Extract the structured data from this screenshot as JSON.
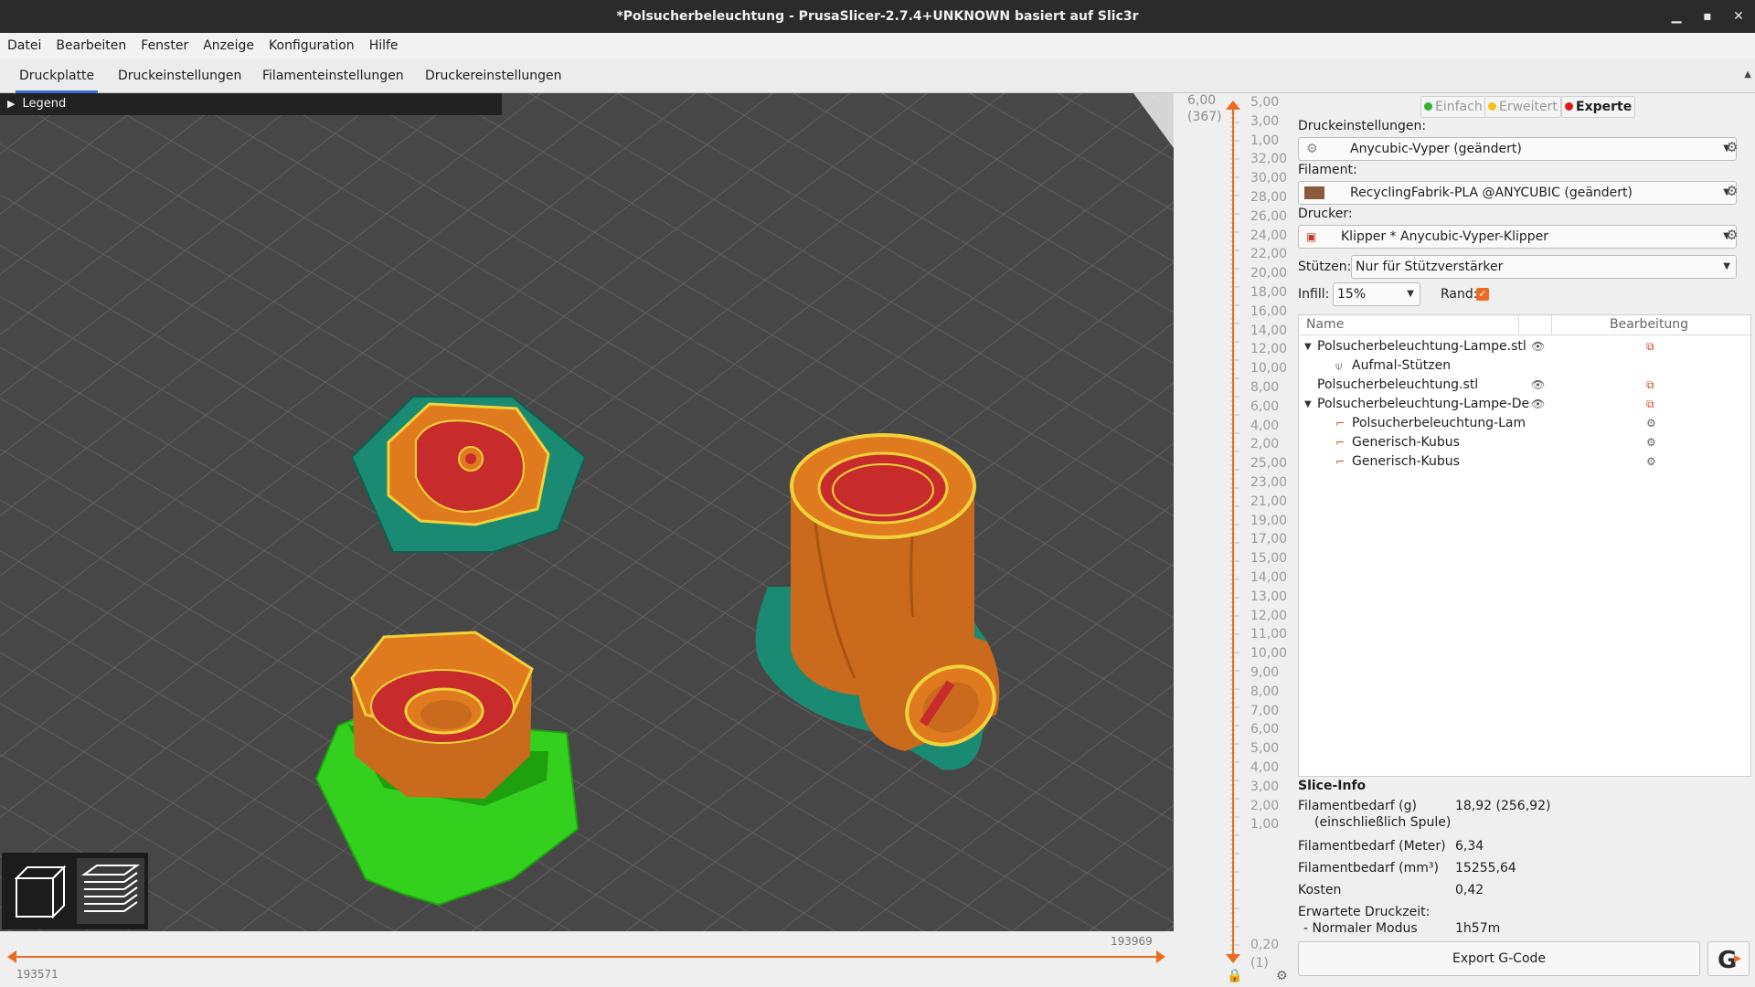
{
  "window": {
    "title": "*Polsucherbeleuchtung - PrusaSlicer-2.7.4+UNKNOWN basiert auf Slic3r",
    "minimize": "▁",
    "maximize": "▪",
    "close": "✕"
  },
  "menu": [
    "Datei",
    "Bearbeiten",
    "Fenster",
    "Anzeige",
    "Konfiguration",
    "Hilfe"
  ],
  "tabs": [
    "Druckplatte",
    "Druckeinstellungen",
    "Filamenteinstellungen",
    "Druckereinstellungen"
  ],
  "active_tab": "Druckplatte",
  "canvas": {
    "legend_label": "Legend"
  },
  "horizontal_slider": {
    "left_value": "193571",
    "right_value": "193969"
  },
  "vertical_slider": {
    "top_value": "6,00",
    "top_layer": "(367)",
    "bottom_value": "0,20",
    "bottom_layer": "(1)",
    "ticks": [
      "5,00",
      "3,00",
      "1,00",
      "32,00",
      "30,00",
      "28,00",
      "26,00",
      "24,00",
      "22,00",
      "20,00",
      "18,00",
      "16,00",
      "14,00",
      "12,00",
      "10,00",
      "8,00",
      "6,00",
      "4,00",
      "2,00",
      "25,00",
      "23,00",
      "21,00",
      "19,00",
      "17,00",
      "15,00",
      "14,00",
      "13,00",
      "12,00",
      "11,00",
      "10,00",
      "9,00",
      "8,00",
      "7,00",
      "6,00",
      "5,00",
      "4,00",
      "3,00",
      "2,00",
      "1,00"
    ]
  },
  "panel": {
    "modes": [
      {
        "label": "Einfach",
        "color": "#2ab52a"
      },
      {
        "label": "Erweitert",
        "color": "#f2c20f"
      },
      {
        "label": "Experte",
        "color": "#e0161b"
      }
    ],
    "active_mode": "Experte",
    "print_settings_label": "Druckeinstellungen:",
    "print_settings_value": "Anycubic-Vyper (geändert)",
    "filament_label": "Filament:",
    "filament_value": "RecyclingFabrik-PLA @ANYCUBIC (geändert)",
    "filament_color": "#8b5a3c",
    "printer_label": "Drucker:",
    "printer_value": "Klipper * Anycubic-Vyper-Klipper",
    "supports_label": "Stützen:",
    "supports_value": "Nur für Stützverstärker",
    "infill_label": "Infill:",
    "infill_value": "15%",
    "brim_label": "Rand:",
    "brim_checked": true
  },
  "object_list": {
    "col_name": "Name",
    "col_edit": "Bearbeitung",
    "rows": [
      {
        "name": "Polsucherbeleuchtung-Lampe.stl",
        "level": 0,
        "expanded": true,
        "eye": true,
        "edit_icon": "object-settings-icon"
      },
      {
        "name": "Aufmal-Stützen",
        "level": 1,
        "icon": "paint-supports-icon"
      },
      {
        "name": "Polsucherbeleuchtung.stl",
        "level": 0,
        "eye": true,
        "edit_icon": "object-settings-icon"
      },
      {
        "name": "Polsucherbeleuchtung-Lampe-De",
        "level": 0,
        "expanded": true,
        "eye": true,
        "edit_icon": "object-settings-icon"
      },
      {
        "name": "Polsucherbeleuchtung-Lam",
        "level": 1,
        "icon": "part-icon",
        "edit_icon": "gear-icon"
      },
      {
        "name": "Generisch-Kubus",
        "level": 1,
        "icon": "part-icon",
        "edit_icon": "gear-icon"
      },
      {
        "name": "Generisch-Kubus",
        "level": 1,
        "icon": "part-icon",
        "edit_icon": "gear-icon"
      }
    ]
  },
  "slice_info": {
    "title": "Slice-Info",
    "rows": [
      {
        "label": "Filamentbedarf (g)",
        "value": "18,92 (256,92)"
      },
      {
        "label": "    (einschließlich Spule)",
        "value": ""
      },
      {
        "label": "Filamentbedarf (Meter)",
        "value": "6,34"
      },
      {
        "label": "Filamentbedarf (mm³)",
        "value": "15255,64"
      },
      {
        "label": "Kosten",
        "value": "0,42"
      },
      {
        "label": "Erwartete Druckzeit:",
        "value": ""
      },
      {
        "label": " - Normaler Modus",
        "value": "1h57m"
      }
    ]
  },
  "export_button": "Export G-Code",
  "colors": {
    "accent": "#ed6b21",
    "perimeter": "#e07a1f",
    "infill": "#c82b2b",
    "skirt": "#1e8a72",
    "support": "#33d11e",
    "bed": "#4a4a4a"
  }
}
